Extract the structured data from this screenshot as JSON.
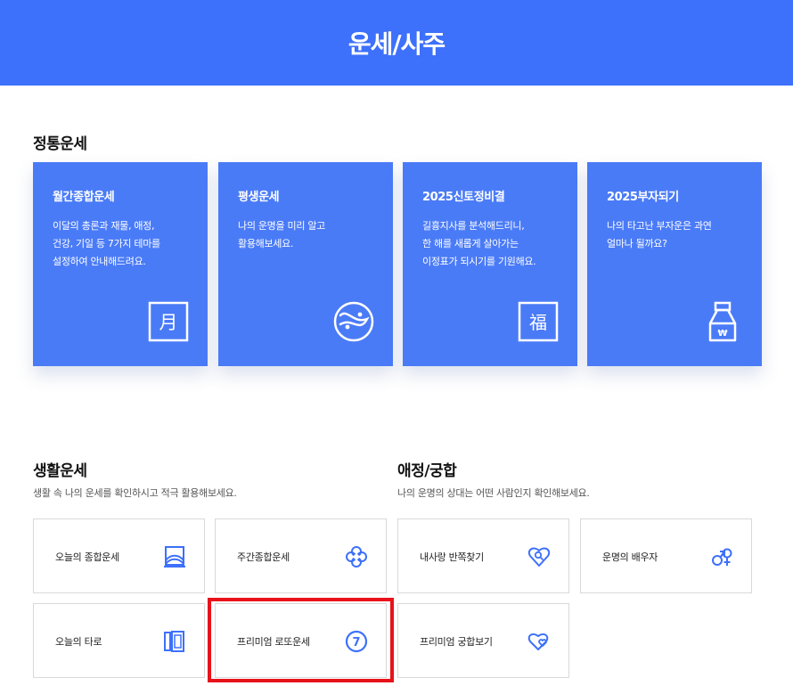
{
  "header": {
    "title": "운세/사주"
  },
  "traditional": {
    "title": "정통운세",
    "cards": [
      {
        "title": "월간종합운세",
        "desc": "이달의 총론과 재물, 애정,\n건강, 기일 등 7가지 테마를\n설정하여 안내해드려요.",
        "icon": "moon-char-icon",
        "glyph": "月"
      },
      {
        "title": "평생운세",
        "desc": "나의 운명을 미리 알고\n활용해보세요.",
        "icon": "yin-yang-icon"
      },
      {
        "title": "2025신토정비결",
        "desc": "길흉지사를 분석해드리니,\n한 해를 새롭게 살아가는\n이정표가 되시기를 기원해요.",
        "icon": "fortune-char-icon",
        "glyph": "福"
      },
      {
        "title": "2025부자되기",
        "desc": "나의 타고난 부자운은 과연\n얼마나 될까요?",
        "icon": "money-bag-icon",
        "glyph": "₩"
      }
    ]
  },
  "life": {
    "title": "생활운세",
    "desc": "생활 속 나의 운세를 확인하시고 적극 활용해보세요.",
    "items": [
      {
        "label": "오늘의 종합운세",
        "icon": "landscape-icon"
      },
      {
        "label": "주간종합운세",
        "icon": "clover-icon"
      },
      {
        "label": "오늘의 타로",
        "icon": "tarot-cards-icon"
      },
      {
        "label": "프리미엄 로또운세",
        "icon": "lotto-ball-icon",
        "glyph": "7"
      }
    ]
  },
  "love": {
    "title": "애정/궁합",
    "desc": "나의 운명의 상대는 어떤 사람인지 확인해보세요.",
    "items": [
      {
        "label": "내사랑 반쪽찾기",
        "icon": "heart-search-icon"
      },
      {
        "label": "운명의 배우자",
        "icon": "gender-symbols-icon"
      },
      {
        "label": "프리미엄 궁합보기",
        "icon": "double-heart-icon"
      }
    ]
  },
  "colors": {
    "brand": "#3d70fb",
    "card": "#4a7bf7",
    "icon": "#3d70fb",
    "highlight": "#e8121b"
  }
}
